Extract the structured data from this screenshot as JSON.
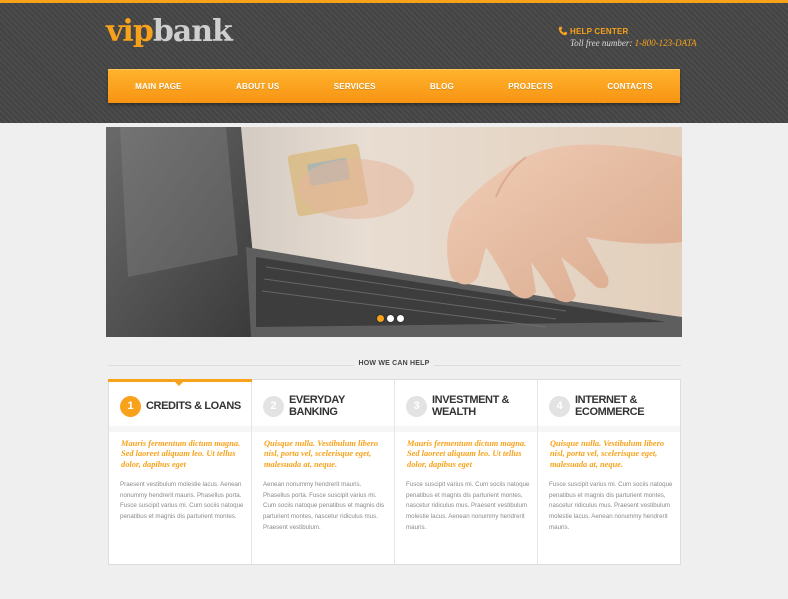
{
  "brand": {
    "logo_vip": "vip",
    "logo_bank": "bank",
    "accent": "#f7a21a",
    "dark": "#464646"
  },
  "help": {
    "icon": "phone-icon",
    "title": "HELP CENTER",
    "tollfree_label": "Toll free number: ",
    "tollfree_number": "1-800-123-DATA"
  },
  "nav": {
    "items": [
      "MAIN PAGE",
      "ABOUT US",
      "SERVICES",
      "BLOG",
      "PROJECTS",
      "CONTACTS"
    ],
    "active": "MAIN PAGE"
  },
  "slider": {
    "slides": 3,
    "current": 1
  },
  "section": {
    "heading": "HOW WE CAN HELP"
  },
  "features": [
    {
      "number": "1",
      "title": "Credits & Loans",
      "lead": "Mauris fermentum dictum magna. Sed laoreet aliquam leo. Ut tellus dolor, dapibus eget",
      "body": "Praesent vestibulum molestie lacus. Aenean nonummy hendrerit mauris. Phasellus porta. Fusce suscipit varius mi. Cum sociis natoque penatibus et magnis dis parturient montes."
    },
    {
      "number": "2",
      "title": "Everyday Banking",
      "lead": "Quisque nulla. Vestibulum libero nisl, porta vel, scelerisque eget, malesuada at, neque.",
      "body": "Aenean nonummy hendrerit mauris. Phasellus porta. Fusce suscipit varius mi. Cum sociis natoque penatibus et magnis dis parturient montes, nascetur ridiculus mus. Praesent vestibulum."
    },
    {
      "number": "3",
      "title": "Investment & Wealth",
      "lead": "Mauris fermentum dictum magna. Sed laoreet aliquam leo. Ut tellus dolor, dapibus eget",
      "body": "Fusce suscipit varius mi. Cum sociis natoque penatibus et magnis dis parturient montes, nascetur ridiculus mus. Praesent vestibulum molestie lacus. Aenean nonummy hendrerit mauris."
    },
    {
      "number": "4",
      "title": "Internet & eCommerce",
      "lead": "Quisque nulla. Vestibulum libero nisl, porta vel, scelerisque eget, malesuada at, neque.",
      "body": "Fusce suscipit varius mi. Cum sociis natoque penatibus et magnis dis parturient montes, nascetur ridiculus mus. Praesent vestibulum molestie lacus. Aenean nonummy hendrerit mauris."
    }
  ]
}
